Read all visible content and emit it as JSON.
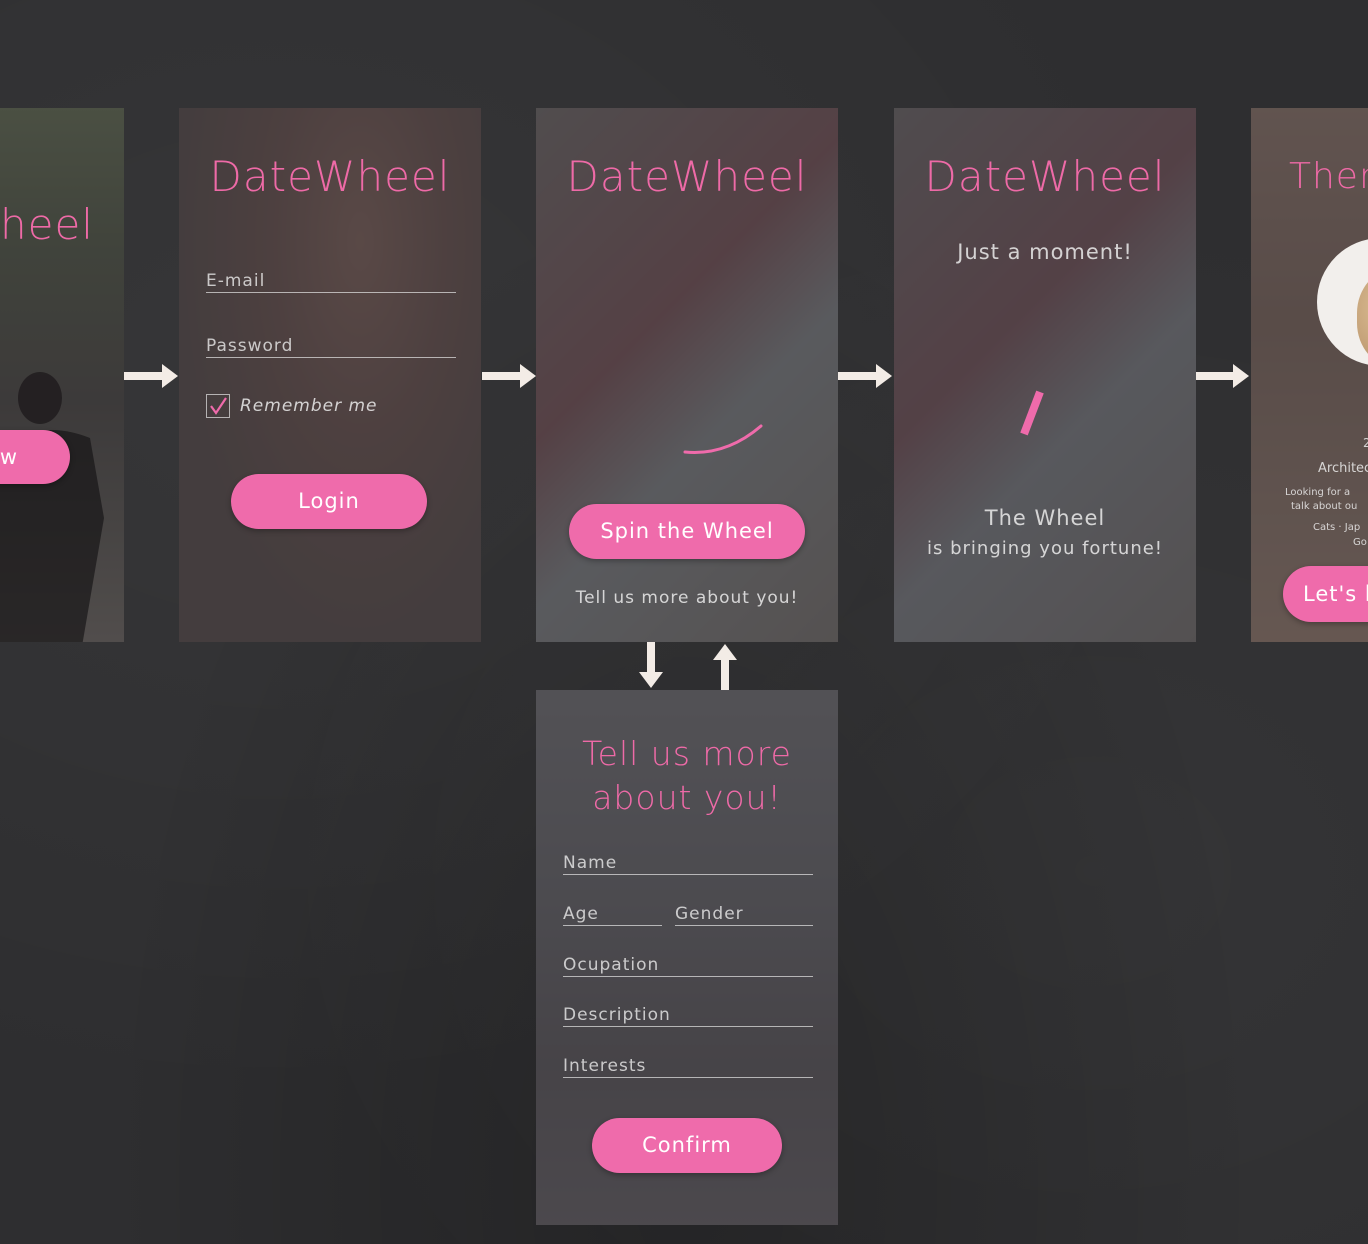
{
  "colors": {
    "accent": "#ef6bab",
    "background": "#2e2e30",
    "arrow": "#f3ece6"
  },
  "screen1": {
    "logo_partial": "heel",
    "button_partial": "w"
  },
  "login": {
    "logo": "DateWheel",
    "email_placeholder": "E-mail",
    "password_placeholder": "Password",
    "remember_label": "Remember me",
    "login_button": "Login"
  },
  "spin": {
    "logo": "DateWheel",
    "spin_button": "Spin the Wheel",
    "more_link": "Tell us more about you!"
  },
  "loading": {
    "logo": "DateWheel",
    "subtitle": "Just a moment!",
    "line1": "The Wheel",
    "line2": "is bringing you fortune!"
  },
  "match": {
    "title_partial": "There",
    "age_partial": "2",
    "occupation_partial": "Architec",
    "desc_line1": "Looking for a",
    "desc_line2": "talk about ou",
    "interests_line1": "Cats · Jap",
    "interests_line2": "Go",
    "button_partial": "Let's h"
  },
  "profile": {
    "title_line1": "Tell us more",
    "title_line2": "about you!",
    "name_placeholder": "Name",
    "age_placeholder": "Age",
    "gender_placeholder": "Gender",
    "occupation_placeholder": "Ocupation",
    "description_placeholder": "Description",
    "interests_placeholder": "Interests",
    "confirm_button": "Confirm"
  }
}
